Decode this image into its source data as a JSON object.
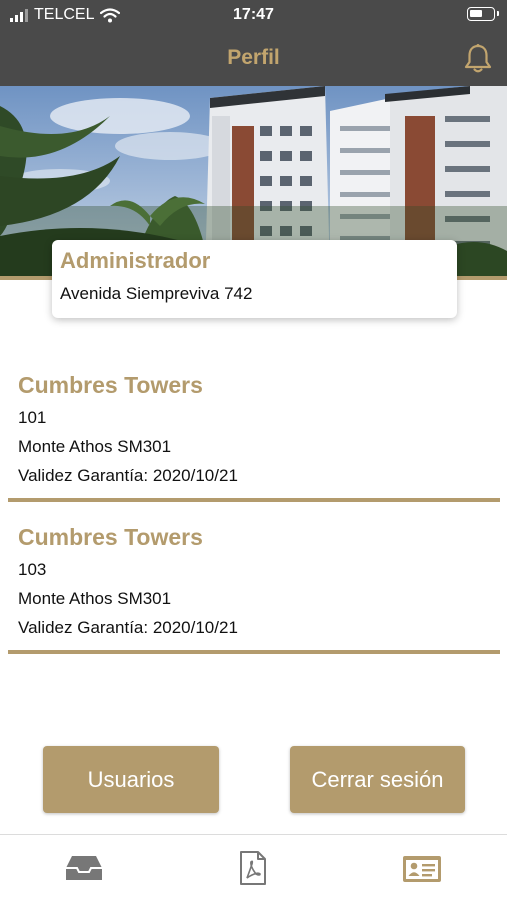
{
  "status_bar": {
    "carrier": "TELCEL",
    "time": "17:47"
  },
  "header": {
    "title": "Perfil"
  },
  "profile": {
    "role": "Administrador",
    "address": "Avenida Siempreviva 742"
  },
  "units": [
    {
      "name": "Cumbres Towers",
      "number": "101",
      "model": "Monte Athos SM301",
      "warranty": "Validez Garantía: 2020/10/21"
    },
    {
      "name": "Cumbres Towers",
      "number": "103",
      "model": "Monte Athos SM301",
      "warranty": "Validez Garantía: 2020/10/21"
    }
  ],
  "actions": {
    "users_label": "Usuarios",
    "logout_label": "Cerrar sesión"
  },
  "tabs": [
    {
      "icon": "inbox-icon"
    },
    {
      "icon": "pdf-document-icon"
    },
    {
      "icon": "id-card-icon",
      "active": true
    }
  ],
  "colors": {
    "accent": "#b39b6d",
    "header_bg": "#4a4a4a",
    "tab_inactive": "#777777"
  }
}
